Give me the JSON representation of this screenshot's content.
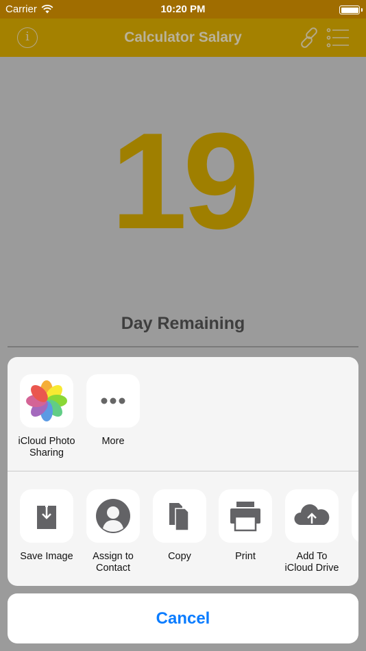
{
  "status": {
    "carrier": "Carrier",
    "time": "10:20 PM",
    "battery_level": 1.0
  },
  "nav": {
    "title": "Calculator Salary"
  },
  "main": {
    "count": "19",
    "caption": "Day Remaining"
  },
  "share_sheet": {
    "apps": [
      {
        "label": "iCloud Photo\nSharing",
        "icon": "photos-icon"
      },
      {
        "label": "More",
        "icon": "more-icon"
      }
    ],
    "actions": [
      {
        "label": "Save Image",
        "icon": "save-image-icon"
      },
      {
        "label": "Assign to\nContact",
        "icon": "contact-icon"
      },
      {
        "label": "Copy",
        "icon": "copy-icon"
      },
      {
        "label": "Print",
        "icon": "print-icon"
      },
      {
        "label": "Add To\niCloud Drive",
        "icon": "icloud-drive-icon"
      }
    ],
    "cancel_label": "Cancel"
  },
  "colors": {
    "status_bar": "#a06d00",
    "nav_bar": "#a48100",
    "accent": "#9f7f00",
    "cancel": "#0a7cff",
    "sheet": "#f5f5f5"
  }
}
